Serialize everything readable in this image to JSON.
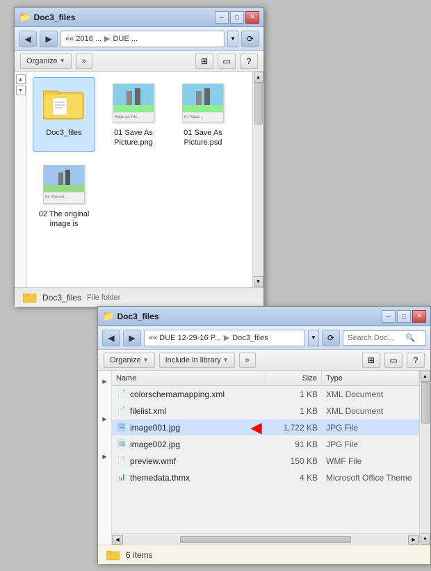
{
  "window1": {
    "title": "Doc3_files",
    "nav": {
      "back_label": "◀",
      "forward_label": "▶",
      "path_parts": [
        "«« 2016 ...",
        "DUE ..."
      ],
      "refresh_label": "⟳"
    },
    "toolbar": {
      "organize_label": "Organize",
      "more_label": "»",
      "view_label": "⊞",
      "pane_label": "▭",
      "help_label": "?"
    },
    "files": [
      {
        "name": "Doc3_files",
        "type": "folder",
        "label": "Doc3_files"
      },
      {
        "name": "01 Save As Picture.png",
        "type": "image_png",
        "label": "01 Save As\nPicture.png"
      },
      {
        "name": "01 Save As Picture.psd",
        "type": "image_psd",
        "label": "01 Save As\nPicture.psd"
      },
      {
        "name": "02 The original image is",
        "type": "image_doc",
        "label": "02 The original\nimage is"
      }
    ],
    "status": {
      "name": "Doc3_files",
      "type": "File folder"
    }
  },
  "window2": {
    "title": "Doc3_files",
    "nav": {
      "back_label": "◀",
      "forward_label": "▶",
      "path_parts": [
        "«« DUE 12-29-16 P...",
        "Doc3_files"
      ],
      "refresh_label": "⟳",
      "search_placeholder": "Search Doc..."
    },
    "toolbar": {
      "organize_label": "Organize",
      "include_label": "Include in library",
      "more_label": "»",
      "view_label": "⊞",
      "pane_label": "▭",
      "help_label": "?"
    },
    "columns": {
      "name": "Name",
      "size": "Size",
      "type": "Type"
    },
    "files": [
      {
        "name": "colorschemamapping.xml",
        "size": "1 KB",
        "type": "XML Document",
        "icon": "xml",
        "highlighted": false
      },
      {
        "name": "filelist.xml",
        "size": "1 KB",
        "type": "XML Document",
        "icon": "xml",
        "highlighted": false
      },
      {
        "name": "image001.jpg",
        "size": "1,722 KB",
        "type": "JPG File",
        "icon": "jpg",
        "highlighted": true,
        "arrow": true
      },
      {
        "name": "image002.jpg",
        "size": "91 KB",
        "type": "JPG File",
        "icon": "jpg",
        "highlighted": false
      },
      {
        "name": "preview.wmf",
        "size": "150 KB",
        "type": "WMF File",
        "icon": "wmf",
        "highlighted": false
      },
      {
        "name": "themedata.thmx",
        "size": "4 KB",
        "type": "Microsoft Office Theme",
        "icon": "thmx",
        "highlighted": false
      }
    ],
    "status": {
      "count": "6 items"
    }
  },
  "icons": {
    "folder_color": "#f5c842",
    "xml_icon": "📄",
    "jpg_icon": "🖼",
    "wmf_icon": "📄",
    "thmx_icon": "📊"
  }
}
